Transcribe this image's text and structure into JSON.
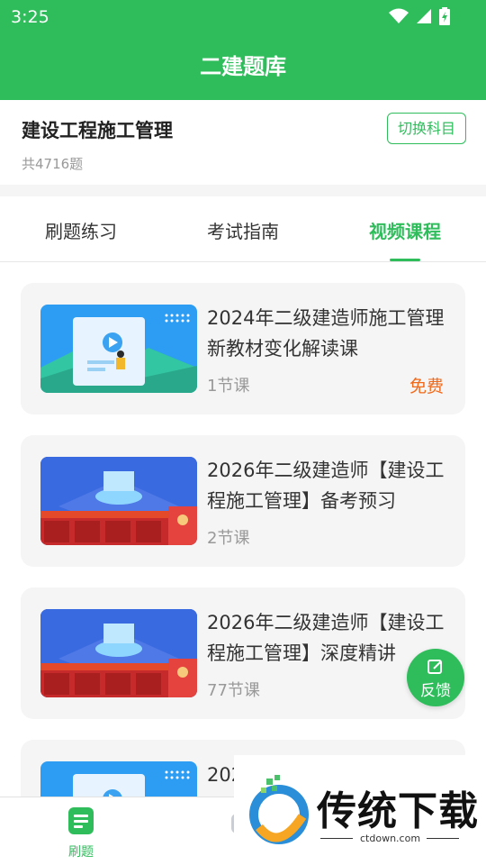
{
  "status_bar": {
    "time": "3:25"
  },
  "header": {
    "title": "二建题库"
  },
  "course": {
    "name": "建设工程施工管理",
    "question_count": "共4716题",
    "switch_label": "切换科目"
  },
  "tabs": [
    {
      "label": "刷题练习",
      "active": false
    },
    {
      "label": "考试指南",
      "active": false
    },
    {
      "label": "视频课程",
      "active": true
    }
  ],
  "videos": [
    {
      "title": "2024年二级建造师施工管理 新教材变化解读课",
      "lessons": "1节课",
      "price": "免费",
      "thumb": "blue-illustration"
    },
    {
      "title": "2026年二级建造师【建设工程施工管理】备考预习",
      "lessons": "2节课",
      "thumb": "promo-banner"
    },
    {
      "title": "2026年二级建造师【建设工程施工管理】深度精讲",
      "lessons": "77节课",
      "thumb": "promo-banner"
    },
    {
      "title": "202",
      "thumb": "blue-illustration"
    }
  ],
  "feedback": {
    "label": "反馈",
    "icon": "edit-icon"
  },
  "bottom_nav": [
    {
      "label": "刷题",
      "icon": "document-icon",
      "active": true
    },
    {
      "label": "",
      "icon": "gift-icon",
      "active": false
    }
  ],
  "watermark": {
    "brand": "传统下载",
    "url": "ctdown.com"
  },
  "colors": {
    "primary": "#2fbd5c",
    "free": "#f06a1c",
    "text": "#333333",
    "muted": "#999999"
  }
}
